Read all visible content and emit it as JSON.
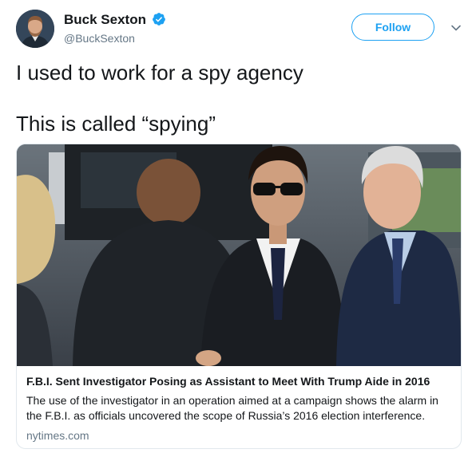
{
  "author": {
    "name": "Buck Sexton",
    "handle": "@BuckSexton",
    "verified": true
  },
  "actions": {
    "follow_label": "Follow"
  },
  "tweet": {
    "lines": [
      "I used to work for a spy agency",
      "This is called “spying”"
    ]
  },
  "card": {
    "title": "F.B.I. Sent Investigator Posing as Assistant to Meet With Trump Aide in 2016",
    "description": "The use of the investigator in an operation aimed at a campaign shows the alarm in the F.B.I. as officials uncovered the scope of Russia’s 2016 election interference.",
    "domain": "nytimes.com"
  },
  "colors": {
    "accent": "#1da1f2",
    "text": "#14171a",
    "muted": "#657786",
    "border": "#e1e8ed"
  },
  "icons": {
    "verified": "verified-badge-icon",
    "more": "chevron-down-icon"
  }
}
